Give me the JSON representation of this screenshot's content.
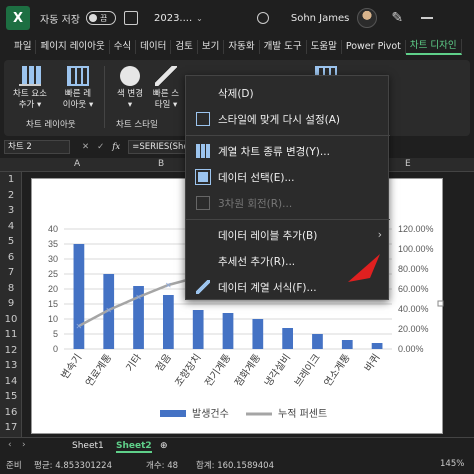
{
  "titlebar": {
    "autosave_label": "자동 저장",
    "autosave_state": "끔",
    "filename": "2023....",
    "username": "Sohn James"
  },
  "tabs": [
    "파일",
    "페이지 레이아웃",
    "수식",
    "데이터",
    "검토",
    "보기",
    "자동화",
    "개발 도구",
    "도움말",
    "Power Pivot",
    "차트 디자인"
  ],
  "ribbon": {
    "groups": [
      {
        "title": "차트 레이아웃",
        "buttons": [
          "차트 요소\n추가 ▾",
          "빠른 레\n이아웃 ▾"
        ]
      },
      {
        "title": "차트 스타일",
        "buttons": [
          "색 변경\n▾",
          "빠른 스\n타일 ▾"
        ]
      }
    ]
  },
  "formula_bar": {
    "name_box": "차트 2",
    "formula": "=SERIES(Shee"
  },
  "columns": [
    "A",
    "B",
    "C",
    "D",
    "E"
  ],
  "rows": [
    "1",
    "2",
    "3",
    "4",
    "5",
    "6",
    "7",
    "8",
    "9",
    "10",
    "11",
    "12",
    "13",
    "14",
    "15",
    "16",
    "17"
  ],
  "chart_data": {
    "type": "bar",
    "categories": [
      "변속기",
      "연료계통",
      "기타",
      "점음",
      "조향장치",
      "전기계통",
      "점화계통",
      "냉각설비",
      "브레이크",
      "연소계통",
      "바퀴"
    ],
    "series": [
      {
        "name": "발생건수",
        "type": "bar",
        "values": [
          35,
          25,
          21,
          18,
          13,
          12,
          10,
          7,
          5,
          3,
          2
        ]
      },
      {
        "name": "누적 퍼센트",
        "type": "line",
        "values": [
          0.23,
          0.39,
          0.52,
          0.64,
          0.72,
          0.8,
          0.86,
          0.91,
          0.94,
          0.97,
          0.99
        ]
      }
    ],
    "y_left": {
      "ticks": [
        "0",
        "5",
        "10",
        "15",
        "20",
        "25",
        "30",
        "35",
        "40"
      ],
      "min": 0,
      "max": 40
    },
    "y_right": {
      "ticks": [
        "0.00%",
        "20.00%",
        "40.00%",
        "60.00%",
        "80.00%",
        "100.00%",
        "120.00%"
      ],
      "min": 0,
      "max": 1.2
    },
    "legend_position": "bottom",
    "colors": {
      "bar": "#4472c4",
      "line": "#a5a5a5"
    }
  },
  "context_menu": {
    "items": [
      {
        "label": "삭제(D)",
        "icon": "delete-icon",
        "disabled": false
      },
      {
        "label": "스타일에 맞게 다시 설정(A)",
        "icon": "reset-style-icon",
        "disabled": false
      },
      {
        "label": "계열 차트 종류 변경(Y)...",
        "icon": "change-chart-type-icon",
        "disabled": false
      },
      {
        "label": "데이터 선택(E)...",
        "icon": "select-data-icon",
        "disabled": false
      },
      {
        "label": "3차원 회전(R)...",
        "icon": "3d-rotation-icon",
        "disabled": true
      },
      {
        "label": "데이터 레이블 추가(B)",
        "icon": "",
        "disabled": false,
        "submenu": true
      },
      {
        "label": "추세선 추가(R)...",
        "icon": "",
        "disabled": false
      },
      {
        "label": "데이터 계열 서식(F)...",
        "icon": "format-series-icon",
        "disabled": false
      }
    ]
  },
  "sheets": {
    "tabs": [
      "Sheet1",
      "Sheet2"
    ],
    "active": "Sheet2"
  },
  "status": {
    "mode": "준비",
    "average": "평균: 4.853301224",
    "count": "개수: 48",
    "sum": "합계: 160.1589404",
    "zoom": "145%"
  }
}
